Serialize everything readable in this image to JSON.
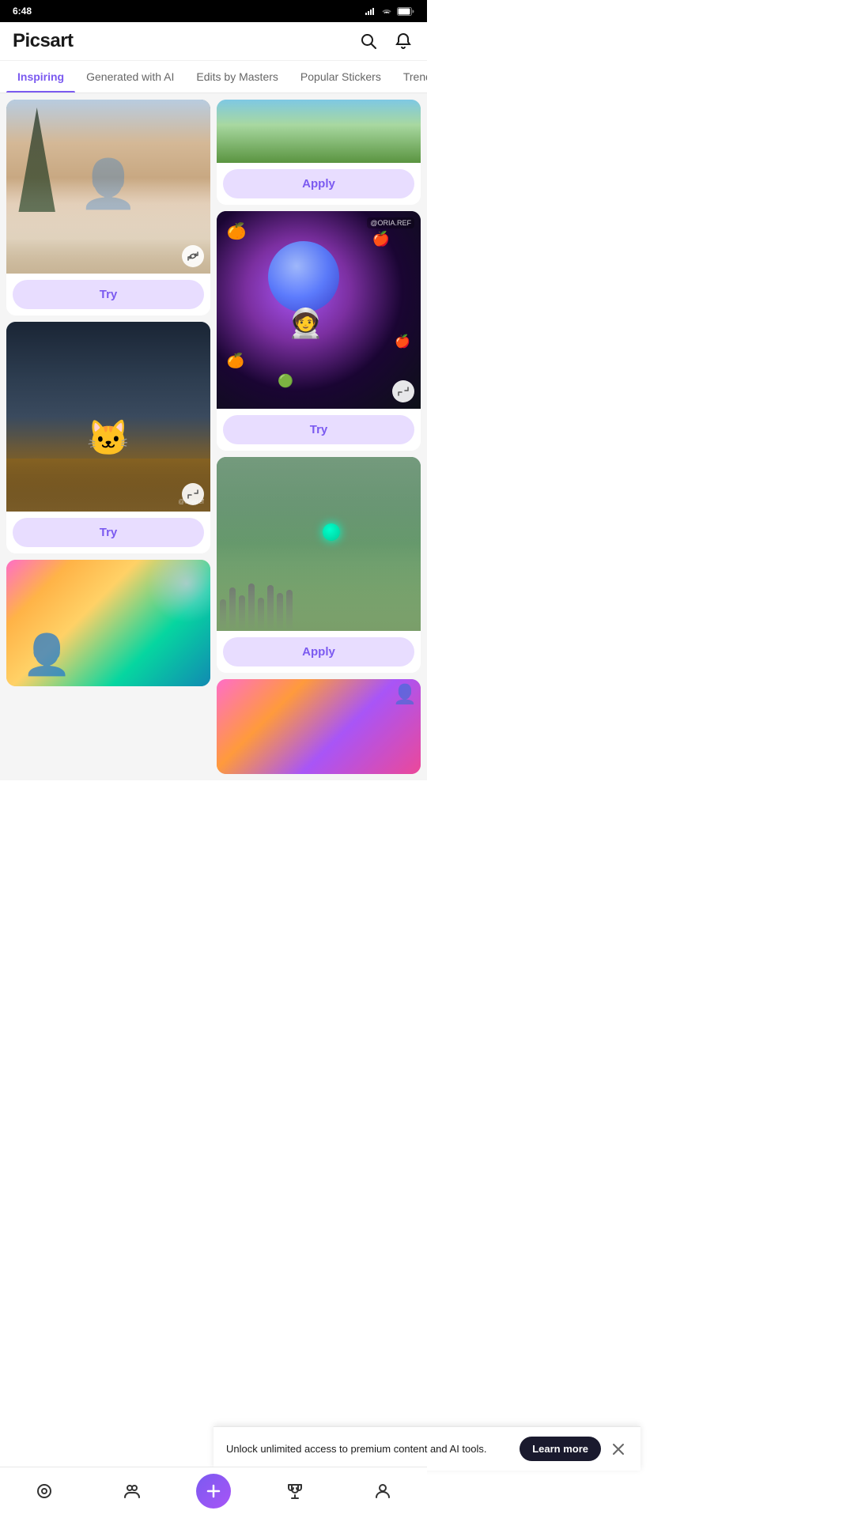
{
  "statusBar": {
    "time": "6:48",
    "icons": [
      "record-icon",
      "picsart-icon",
      "media-icon"
    ]
  },
  "header": {
    "logo": "Picsart",
    "searchLabel": "search",
    "notificationLabel": "notification"
  },
  "tabs": [
    {
      "id": "inspiring",
      "label": "Inspiring",
      "active": true
    },
    {
      "id": "generated-ai",
      "label": "Generated with AI",
      "active": false
    },
    {
      "id": "edits-masters",
      "label": "Edits by Masters",
      "active": false
    },
    {
      "id": "popular-stickers",
      "label": "Popular Stickers",
      "active": false
    },
    {
      "id": "trending",
      "label": "Trending",
      "active": false
    }
  ],
  "leftColumn": [
    {
      "type": "try",
      "imageType": "woman",
      "buttonLabel": "Try",
      "hasRefresh": true
    },
    {
      "type": "try",
      "imageType": "cat",
      "buttonLabel": "Try",
      "hasRefresh": true,
      "watermark": "@oriajref"
    },
    {
      "type": "partial",
      "imageType": "abstract"
    }
  ],
  "rightColumn": [
    {
      "type": "apply",
      "imageType": "field-top",
      "buttonLabel": "Apply"
    },
    {
      "type": "try",
      "imageType": "space",
      "buttonLabel": "Try",
      "hasRefresh": true,
      "watermark": "@orialtef"
    },
    {
      "type": "apply",
      "imageType": "meadow",
      "buttonLabel": "Apply"
    },
    {
      "type": "partial",
      "imageType": "pink-bottom"
    }
  ],
  "banner": {
    "text": "Unlock unlimited access to premium content and AI tools.",
    "learnMore": "Learn more",
    "closeLabel": "close"
  },
  "bottomNav": [
    {
      "id": "home",
      "icon": "home-icon"
    },
    {
      "id": "community",
      "icon": "community-icon"
    },
    {
      "id": "add",
      "icon": "add-icon"
    },
    {
      "id": "trophy",
      "icon": "trophy-icon"
    },
    {
      "id": "profile",
      "icon": "profile-icon"
    }
  ]
}
